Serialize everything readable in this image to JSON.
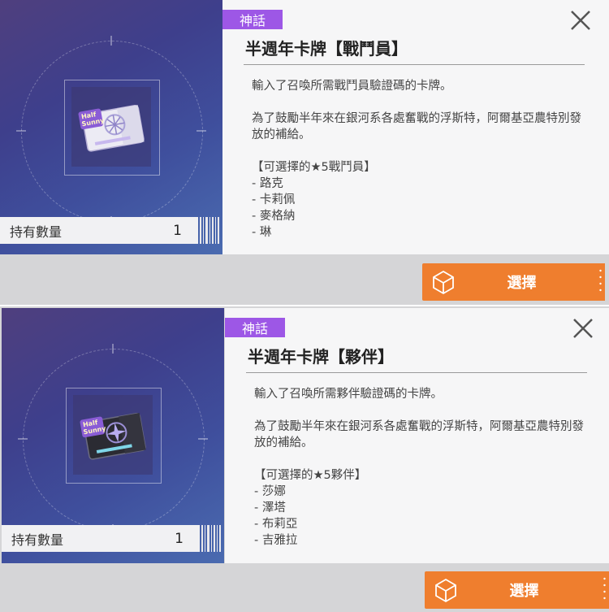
{
  "panels": [
    {
      "badge": "神話",
      "title": "半週年卡牌【戰鬥員】",
      "desc_line1": "輸入了召喚所需戰鬥員驗證碼的卡牌。",
      "desc_line2": "為了鼓勵半年來在銀河系各處奮戰的浮斯特，阿爾基亞農特別發放的補給。",
      "list_header": "【可選擇的★5戰鬥員】",
      "list_items": [
        "- 路克",
        "- 卡莉佩",
        "- 麥格納",
        "- 琳"
      ],
      "count_label": "持有數量",
      "count_value": "1",
      "select_label": "選擇",
      "card_color": "#e9e6f3"
    },
    {
      "badge": "神話",
      "title": "半週年卡牌【夥伴】",
      "desc_line1": "輸入了召喚所需夥伴驗證碼的卡牌。",
      "desc_line2": "為了鼓勵半年來在銀河系各處奮戰的浮斯特，阿爾基亞農特別發放的補給。",
      "list_header": "【可選擇的★5夥伴】",
      "list_items": [
        "- 莎娜",
        "- 澤塔",
        "- 布莉亞",
        "- 吉雅拉"
      ],
      "count_label": "持有數量",
      "count_value": "1",
      "select_label": "選擇",
      "card_color": "#2b2b33"
    }
  ],
  "colors": {
    "badge": "#9d57e6",
    "select_button": "#ef7e2e",
    "count_bar": "#f1f1f3",
    "right_panel": "#f6f6f7"
  },
  "icons": {
    "close": "close-icon",
    "select": "cube-icon",
    "card": "half-sunny-card-icon"
  }
}
